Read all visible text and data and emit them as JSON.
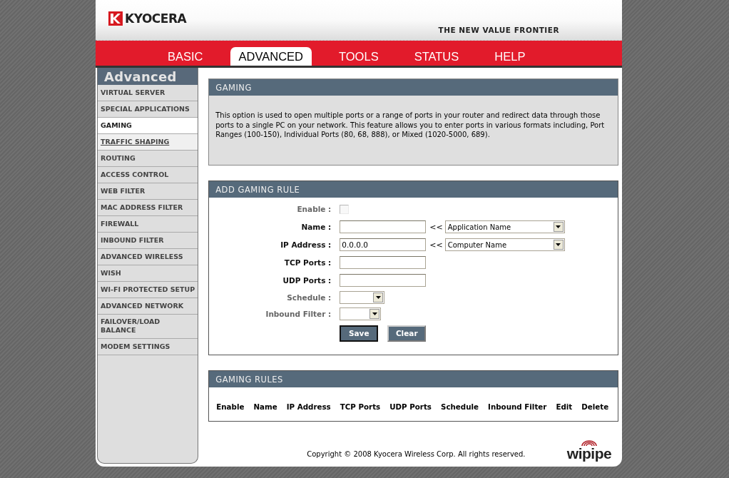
{
  "header": {
    "logo": "KYOCERA",
    "tagline": "THE NEW VALUE FRONTIER"
  },
  "nav": [
    {
      "label": "BASIC",
      "selected": false
    },
    {
      "label": "ADVANCED",
      "selected": true
    },
    {
      "label": "TOOLS",
      "selected": false
    },
    {
      "label": "STATUS",
      "selected": false
    },
    {
      "label": "HELP",
      "selected": false
    }
  ],
  "sidebar": {
    "title": "Advanced",
    "items": [
      {
        "label": "VIRTUAL SERVER",
        "selected": false,
        "hovered": false
      },
      {
        "label": "SPECIAL APPLICATIONS",
        "selected": false,
        "hovered": false
      },
      {
        "label": "GAMING",
        "selected": true,
        "hovered": false
      },
      {
        "label": "TRAFFIC SHAPING",
        "selected": false,
        "hovered": true
      },
      {
        "label": "ROUTING",
        "selected": false,
        "hovered": false
      },
      {
        "label": "ACCESS CONTROL",
        "selected": false,
        "hovered": false
      },
      {
        "label": "WEB FILTER",
        "selected": false,
        "hovered": false
      },
      {
        "label": "MAC ADDRESS FILTER",
        "selected": false,
        "hovered": false
      },
      {
        "label": "FIREWALL",
        "selected": false,
        "hovered": false
      },
      {
        "label": "INBOUND FILTER",
        "selected": false,
        "hovered": false
      },
      {
        "label": "ADVANCED WIRELESS",
        "selected": false,
        "hovered": false
      },
      {
        "label": "WISH",
        "selected": false,
        "hovered": false
      },
      {
        "label": "WI-FI PROTECTED SETUP",
        "selected": false,
        "hovered": false
      },
      {
        "label": "ADVANCED NETWORK",
        "selected": false,
        "hovered": false
      },
      {
        "label": "FAILOVER/LOAD BALANCE",
        "selected": false,
        "hovered": false
      },
      {
        "label": "MODEM SETTINGS",
        "selected": false,
        "hovered": false
      }
    ]
  },
  "intro": {
    "title": "GAMING",
    "text": "This option is used to open multiple ports or a range of ports in your router and redirect data through those ports to a single PC on your network. This feature allows you to enter ports in various formats including, Port Ranges (100-150), Individual Ports (80, 68, 888), or Mixed (1020-5000, 689)."
  },
  "add_rule": {
    "title": "ADD GAMING RULE",
    "fields": [
      {
        "kind": "checkbox",
        "label": "Enable :",
        "disabled": true,
        "checked": false
      },
      {
        "kind": "text-picker",
        "label": "Name :",
        "disabled": false,
        "arrow": "<<",
        "picker": "Application Name"
      },
      {
        "kind": "text-picker",
        "label": "IP Address :",
        "disabled": false,
        "value": "0.0.0.0",
        "arrow": "<<",
        "picker": "Computer Name"
      },
      {
        "kind": "text",
        "label": "TCP Ports :",
        "disabled": false
      },
      {
        "kind": "text",
        "label": "UDP Ports :",
        "disabled": false
      },
      {
        "kind": "select",
        "label": "Schedule :",
        "disabled": true
      },
      {
        "kind": "select",
        "label": "Inbound Filter :",
        "disabled": true
      }
    ],
    "buttons": [
      {
        "label": "Save",
        "selected": true
      },
      {
        "label": "Clear",
        "selected": false
      }
    ]
  },
  "rules": {
    "title": "GAMING RULES",
    "columns": [
      "Enable",
      "Name",
      "IP Address",
      "TCP Ports",
      "UDP Ports",
      "Schedule",
      "Inbound Filter",
      "Edit",
      "Delete"
    ]
  },
  "footer": {
    "copyright": "Copyright © 2008 Kyocera Wireless Corp. All rights reserved.",
    "logo": "wipipe"
  }
}
